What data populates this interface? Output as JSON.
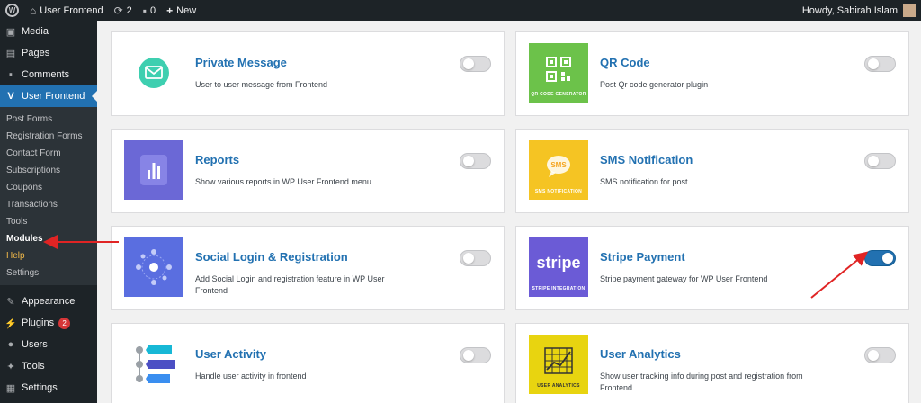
{
  "adminbar": {
    "site_name": "User Frontend",
    "updates_count": "2",
    "comments_count": "0",
    "new_label": "New",
    "greeting": "Howdy, Sabirah Islam"
  },
  "sidebar": {
    "top_items": [
      {
        "label": "Media",
        "icon": "media-icon"
      },
      {
        "label": "Pages",
        "icon": "pages-icon"
      },
      {
        "label": "Comments",
        "icon": "comments-icon"
      }
    ],
    "current": {
      "label": "User Frontend",
      "icon": "user-frontend-icon"
    },
    "submenu": [
      "Post Forms",
      "Registration Forms",
      "Contact Form",
      "Subscriptions",
      "Coupons",
      "Transactions",
      "Tools",
      "Modules",
      "Help",
      "Settings"
    ],
    "bottom_items": [
      {
        "label": "Appearance",
        "icon": "appearance-icon"
      },
      {
        "label": "Plugins",
        "icon": "plugins-icon",
        "badge": "2"
      },
      {
        "label": "Users",
        "icon": "users-icon"
      },
      {
        "label": "Tools",
        "icon": "tools-icon"
      },
      {
        "label": "Settings",
        "icon": "settings-icon"
      }
    ]
  },
  "modules": [
    {
      "title": "Private Message",
      "desc": "User to user message from Frontend",
      "enabled": false,
      "thumb_color": "#ffffff",
      "icon": "message-icon"
    },
    {
      "title": "QR Code",
      "desc": "Post Qr code generator plugin",
      "enabled": false,
      "thumb_color": "#6cc24a",
      "thumb_label": "QR CODE GENERATOR",
      "icon": "qr-code-icon"
    },
    {
      "title": "Reports",
      "desc": "Show various reports in WP User Frontend menu",
      "enabled": false,
      "thumb_color": "#6b68d6",
      "icon": "reports-icon"
    },
    {
      "title": "SMS Notification",
      "desc": "SMS notification for post",
      "enabled": false,
      "thumb_color": "#f5c423",
      "thumb_label": "SMS NOTIFICATION",
      "icon": "sms-icon"
    },
    {
      "title": "Social Login & Registration",
      "desc": "Add Social Login and registration feature in WP User Frontend",
      "enabled": false,
      "thumb_color": "#5a6ee0",
      "icon": "social-login-icon"
    },
    {
      "title": "Stripe Payment",
      "desc": "Stripe payment gateway for WP User Frontend",
      "enabled": true,
      "thumb_color": "#6b5bd6",
      "thumb_word": "stripe",
      "thumb_label": "STRIPE INTEGRATION",
      "icon": "stripe-icon"
    },
    {
      "title": "User Activity",
      "desc": "Handle user activity in frontend",
      "enabled": false,
      "thumb_color": "#ffffff",
      "icon": "user-activity-icon"
    },
    {
      "title": "User Analytics",
      "desc": "Show user tracking info during post and registration from Frontend",
      "enabled": false,
      "thumb_color": "#e8d410",
      "thumb_label": "USER ANALYTICS",
      "icon": "user-analytics-icon"
    }
  ],
  "colors": {
    "accent": "#2271b1",
    "annotation_arrow": "#e02424"
  }
}
